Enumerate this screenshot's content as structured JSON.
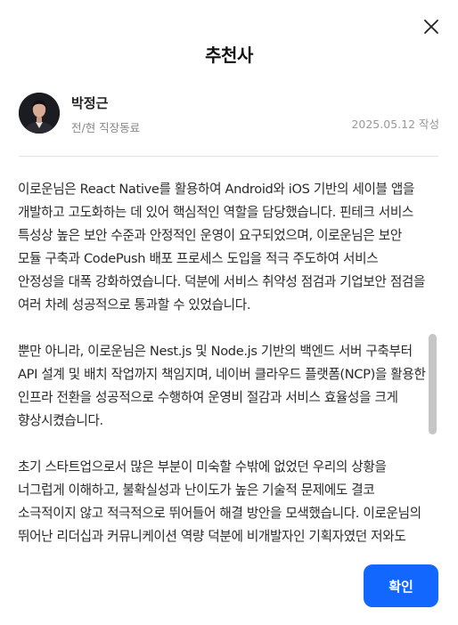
{
  "modal": {
    "title": "추천사",
    "close_icon": "close-icon"
  },
  "recommender": {
    "name": "박정근",
    "relation": "전/현 직장동료",
    "date": "2025.05.12 작성"
  },
  "paragraphs": [
    "이로운님은 React Native를 활용하여 Android와 iOS 기반의 세이블 앱을 개발하고 고도화하는 데 있어 핵심적인 역할을 담당했습니다. 핀테크 서비스 특성상 높은 보안 수준과 안정적인 운영이 요구되었으며, 이로운님은 보안 모듈 구축과 CodePush 배포 프로세스 도입을 적극 주도하여 서비스 안정성을 대폭 강화하였습니다. 덕분에 서비스 취약성 점검과 기업보안 점검을 여러 차례 성공적으로 통과할 수 있었습니다.",
    "뿐만 아니라, 이로운님은 Nest.js 및 Node.js 기반의 백엔드 서버 구축부터 API 설계 및 배치 작업까지 책임지며, 네이버 클라우드 플랫폼(NCP)을 활용한 인프라 전환을 성공적으로 수행하여 운영비 절감과 서비스 효율성을 크게 향상시켰습니다.",
    "초기 스타트업으로서 많은 부분이 미숙할 수밖에 없었던 우리의 상황을 너그럽게 이해하고, 불확실성과 난이도가 높은 기술적 문제에도 결코 소극적이지 않고 적극적으로 뛰어들어 해결 방안을 모색했습니다. 이로운님의 뛰어난 리더십과 커뮤니케이션 역량 덕분에 비개발자인 기획자였던 저와도"
  ],
  "footer": {
    "confirm_label": "확인"
  },
  "colors": {
    "accent": "#1167ff",
    "divider": "#e3e3e3",
    "muted_text": "#888888"
  }
}
